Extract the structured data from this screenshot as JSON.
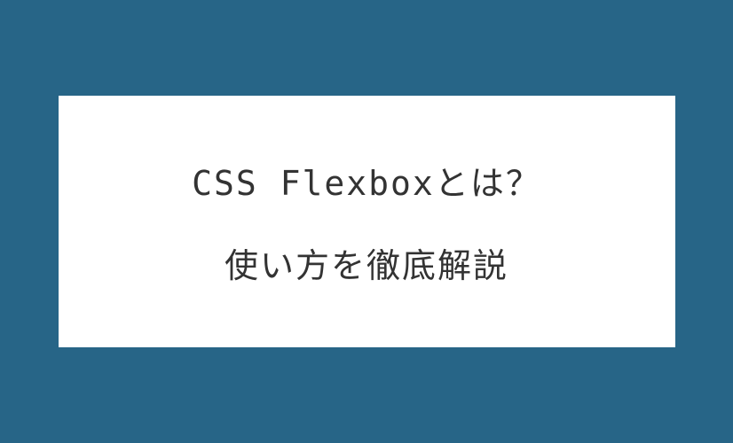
{
  "card": {
    "line1": "CSS Flexboxとは？",
    "line2": "使い方を徹底解説"
  },
  "colors": {
    "background": "#276587",
    "card_background": "#ffffff",
    "text": "#333333"
  }
}
